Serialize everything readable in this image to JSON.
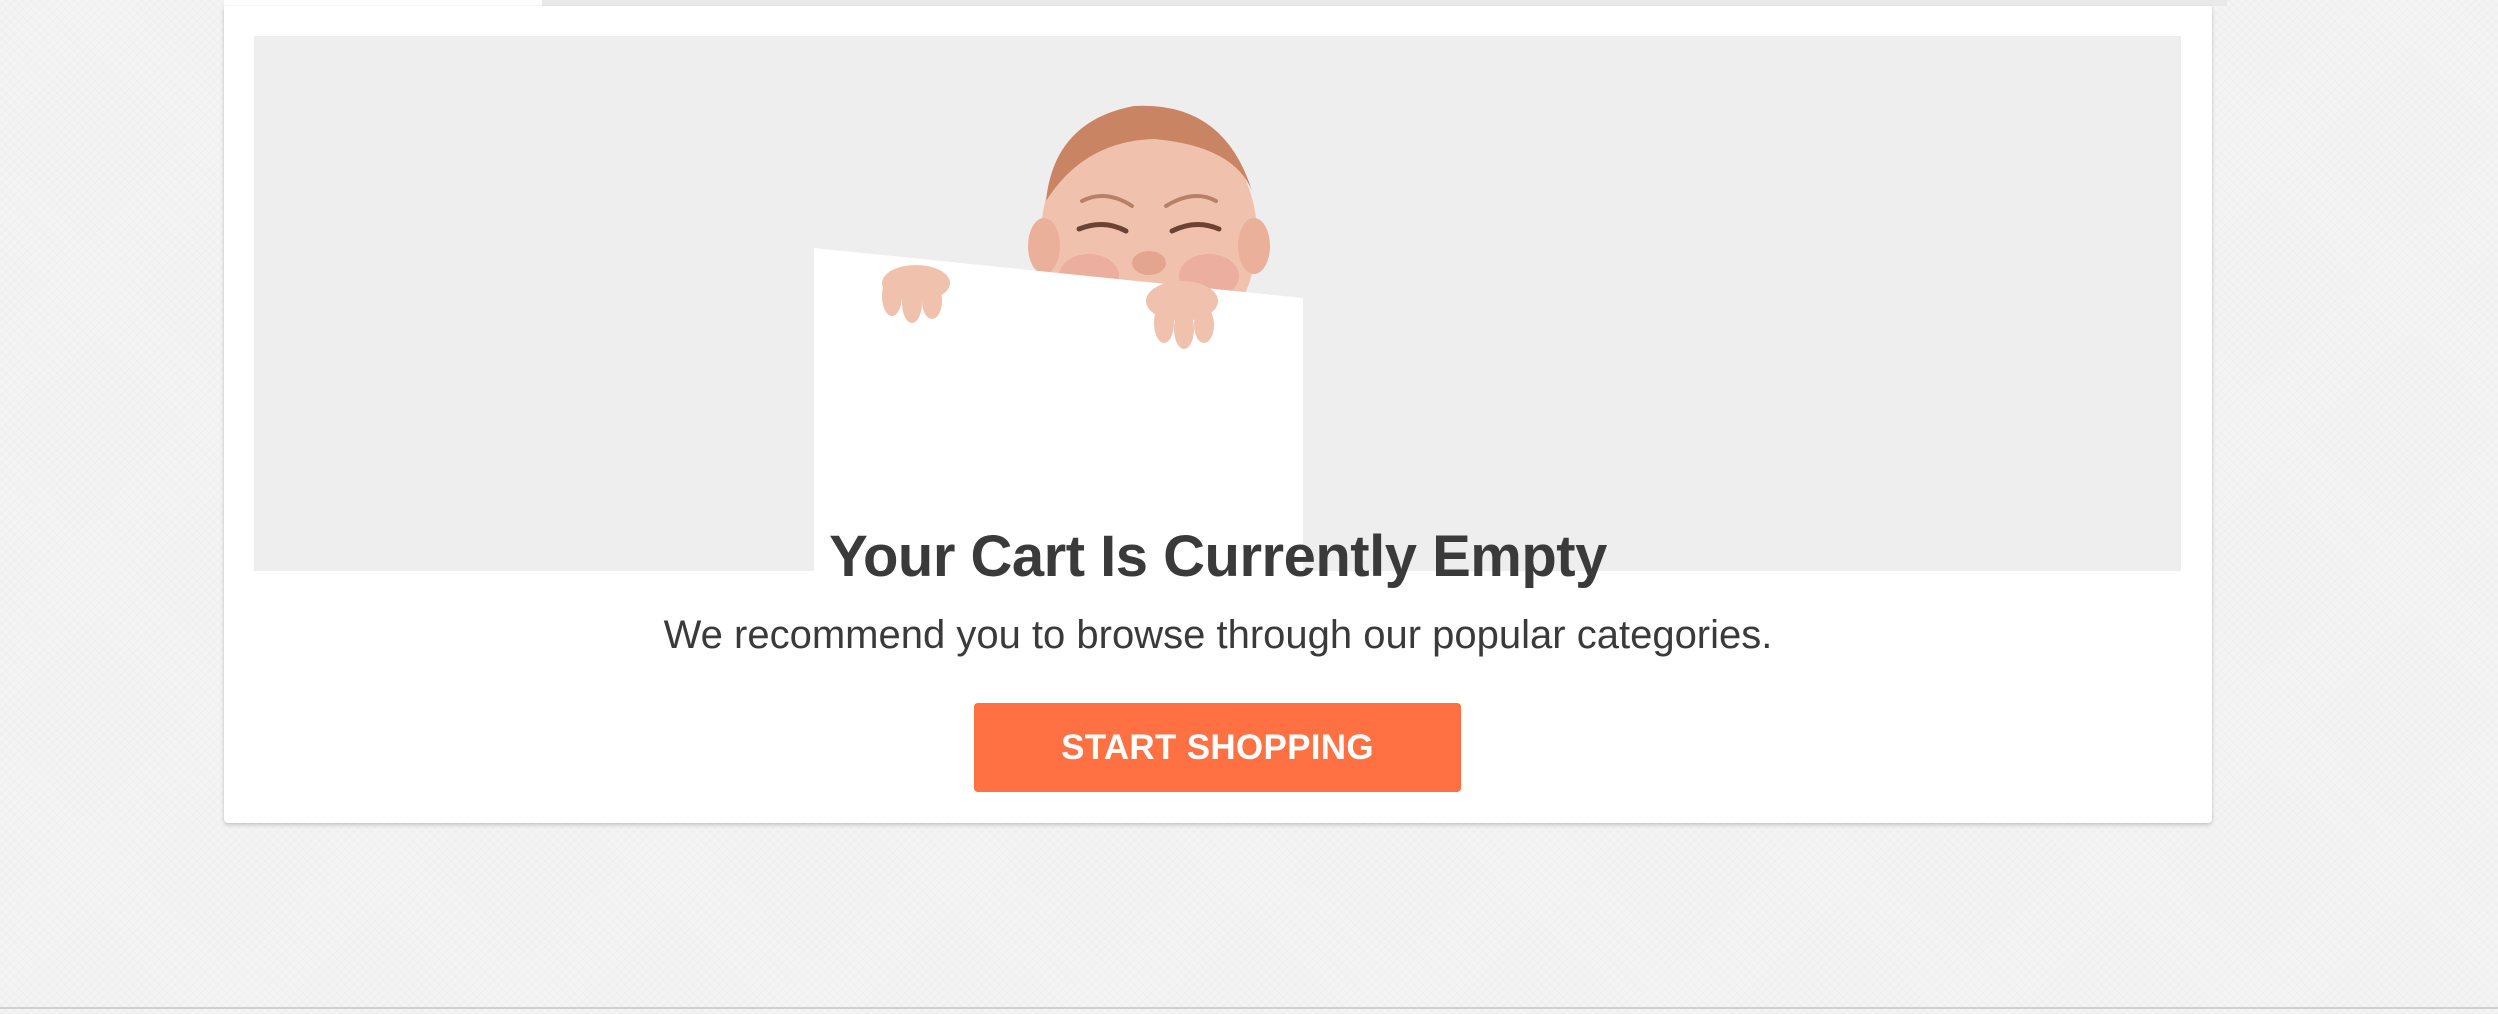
{
  "empty_cart": {
    "title": "Your Cart Is Currently Empty",
    "subtitle": "We recommend you to browse through our popular categories.",
    "cta_label": "START SHOPPING"
  },
  "colors": {
    "accent": "#ff7043",
    "text": "#3a3a3a",
    "hero_background": "#eeeeee",
    "page_background": "#f4f4f4"
  },
  "illustration": {
    "icon": "crying-baby-holding-sign"
  }
}
